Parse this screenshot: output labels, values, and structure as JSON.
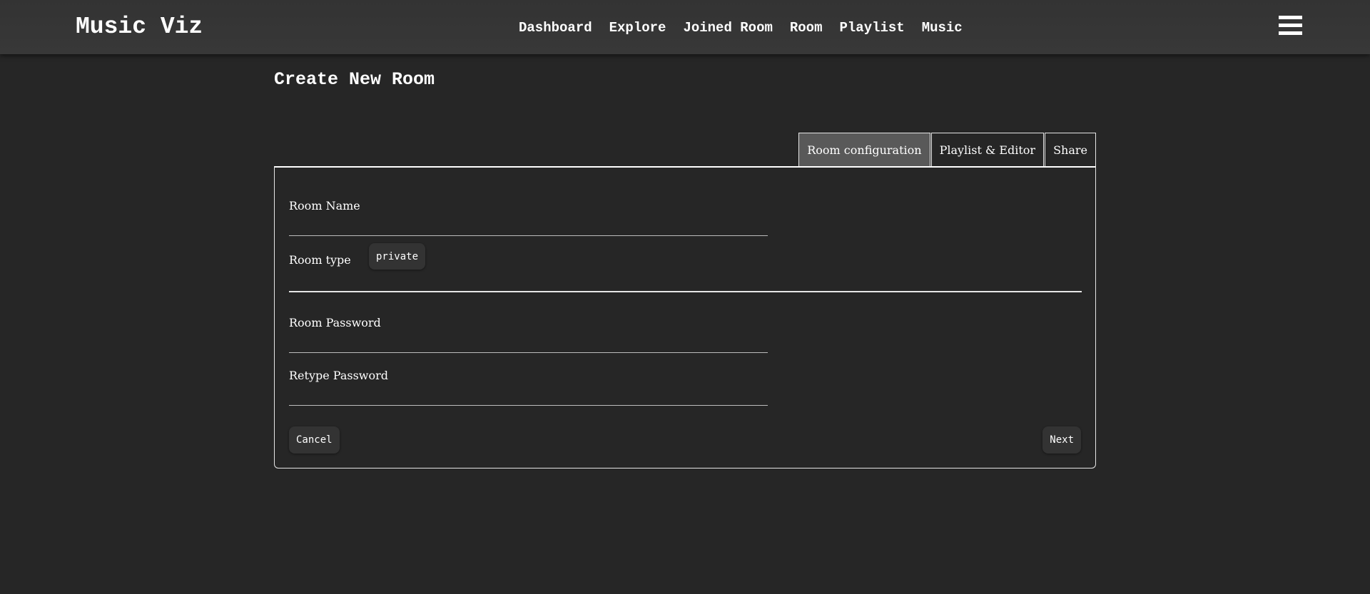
{
  "app": {
    "brand": "Music Viz"
  },
  "nav": {
    "links": [
      "Dashboard",
      "Explore",
      "Joined Room",
      "Room",
      "Playlist",
      "Music"
    ],
    "menu_icon": "hamburger-menu-icon"
  },
  "page": {
    "title": "Create New Room"
  },
  "tabs": [
    {
      "label": "Room configuration",
      "active": true
    },
    {
      "label": "Playlist & Editor",
      "active": false
    },
    {
      "label": "Share",
      "active": false
    }
  ],
  "form": {
    "room_name": {
      "label": "Room Name",
      "value": ""
    },
    "room_type": {
      "label": "Room type",
      "value": "private"
    },
    "room_password": {
      "label": "Room Password",
      "value": ""
    },
    "retype_password": {
      "label": "Retype Password",
      "value": ""
    }
  },
  "actions": {
    "cancel_label": "Cancel",
    "next_label": "Next"
  },
  "colors": {
    "background": "#262626",
    "navbar": "#363636",
    "active_tab": "#595959",
    "border": "#e6e6e6",
    "text": "#ffffff"
  }
}
